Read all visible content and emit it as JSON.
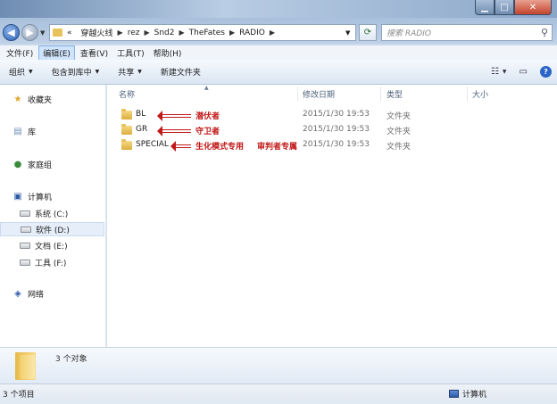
{
  "address": {
    "overflow": "«",
    "crumbs": [
      "穿越火线",
      "rez",
      "Snd2",
      "TheFates",
      "RADIO"
    ]
  },
  "search": {
    "placeholder": "搜索 RADIO"
  },
  "menu": [
    {
      "label": "文件(F)",
      "active": false
    },
    {
      "label": "编辑(E)",
      "active": true
    },
    {
      "label": "查看(V)",
      "active": false
    },
    {
      "label": "工具(T)",
      "active": false
    },
    {
      "label": "帮助(H)",
      "active": false
    }
  ],
  "commands": [
    "组织",
    "包含到库中",
    "共享",
    "新建文件夹"
  ],
  "nav": {
    "favorites": "收藏夹",
    "libraries": "库",
    "homegroup": "家庭组",
    "computer": "计算机",
    "drives": [
      "系统 (C:)",
      "软件 (D:)",
      "文档 (E:)",
      "工具 (F:)"
    ],
    "selected_drive": "软件 (D:)",
    "network": "网络"
  },
  "columns": {
    "name": "名称",
    "modified": "修改日期",
    "type": "类型",
    "size": "大小"
  },
  "files": [
    {
      "name": "BL",
      "modified": "2015/1/30 19:53",
      "type": "文件夹",
      "annotation": "潜伏者"
    },
    {
      "name": "GR",
      "modified": "2015/1/30 19:53",
      "type": "文件夹",
      "annotation": "守卫者"
    },
    {
      "name": "SPECIAL",
      "modified": "2015/1/30 19:53",
      "type": "文件夹",
      "annotation": "生化模式专用",
      "annotation2": "审判者专属"
    }
  ],
  "details": {
    "count_text": "3 个对象"
  },
  "status": {
    "left": "3 个项目",
    "right": "计算机"
  },
  "colors": {
    "annotation": "#c21818",
    "selection": "#e5eef9",
    "folder": "#e6c25c"
  }
}
